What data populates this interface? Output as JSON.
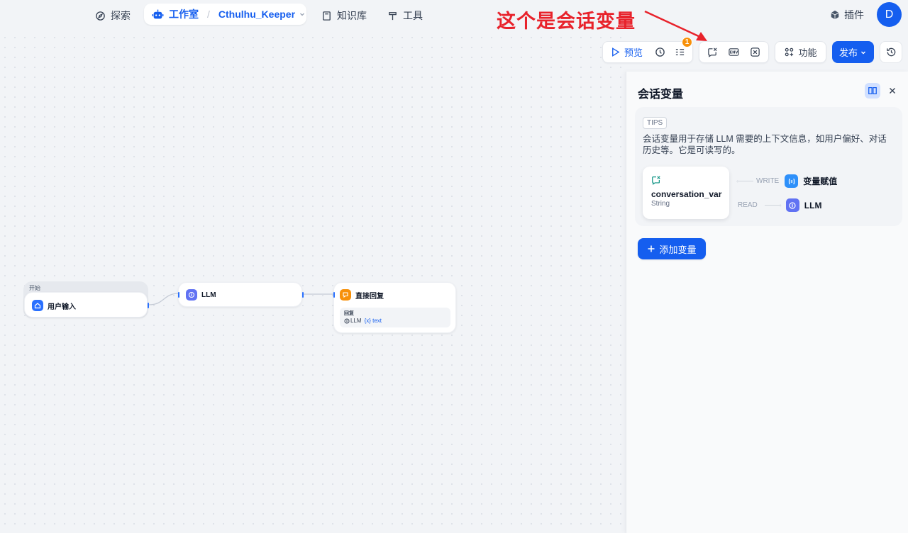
{
  "nav": {
    "explore": "探索",
    "studio": "工作室",
    "app_name": "Cthulhu_Keeper",
    "knowledge": "知识库",
    "tools": "工具",
    "plugins": "插件",
    "avatar_letter": "D"
  },
  "annotation": {
    "text": "这个是会话变量",
    "color": "#e8222b"
  },
  "toolbar": {
    "preview": "预览",
    "checklist_badge": "1",
    "features": "功能",
    "publish": "发布",
    "env_label": "ENV"
  },
  "nodes": {
    "start": {
      "section": "开始",
      "title": "用户输入"
    },
    "llm": {
      "title": "LLM"
    },
    "answer": {
      "title": "直接回复",
      "field_label": "回复",
      "source": "LLM",
      "variable": "{x} text"
    }
  },
  "panel": {
    "title": "会话变量",
    "tips_tag": "TIPS",
    "tips_text": "会话变量用于存储 LLM 需要的上下文信息，如用户偏好、对话历史等。它是可读写的。",
    "var_name": "conversation_var",
    "var_type": "String",
    "write_label": "WRITE",
    "write_target": "变量赋值",
    "read_label": "READ",
    "read_target": "LLM",
    "add_button": "添加变量"
  },
  "colors": {
    "accent": "#155eef",
    "llm_icon": "#6172f3",
    "answer_icon": "#f79009",
    "start_icon": "#2970ff",
    "assign_icon": "#2e90fa",
    "badge": "#f79009"
  }
}
